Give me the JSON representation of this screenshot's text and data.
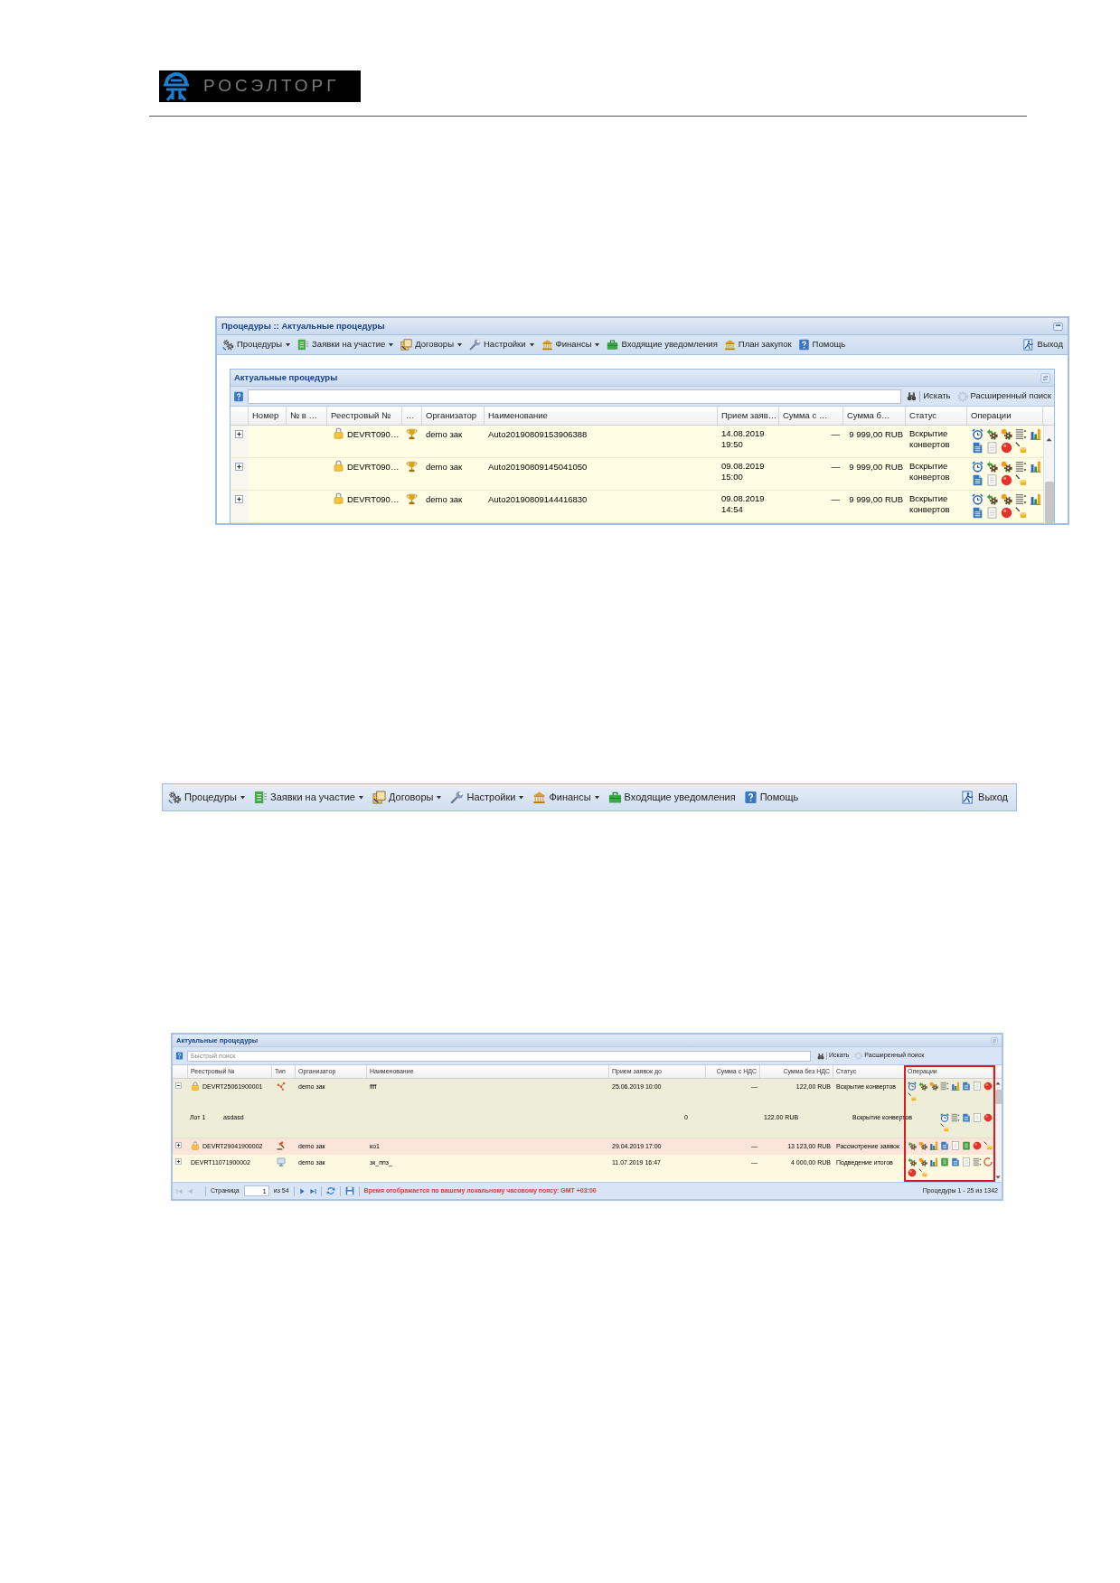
{
  "header": {
    "logo_text": "РОСЭЛТОРГ"
  },
  "procedures_window": {
    "title": "Процедуры :: Актуальные процедуры",
    "toolbar": {
      "items": [
        {
          "kind": "gears",
          "label": "Процедуры",
          "dropdown": true
        },
        {
          "kind": "sheet",
          "label": "Заявки на участие",
          "dropdown": true
        },
        {
          "kind": "documents",
          "label": "Договоры",
          "dropdown": true
        },
        {
          "kind": "wrench",
          "label": "Настройки",
          "dropdown": true
        },
        {
          "kind": "bank",
          "label": "Финансы",
          "dropdown": true
        },
        {
          "kind": "briefcase",
          "label": "Входящие уведомления",
          "dropdown": false
        },
        {
          "kind": "bank",
          "label": "План закупок",
          "dropdown": false
        },
        {
          "kind": "help",
          "label": "Помощь",
          "dropdown": false
        }
      ],
      "exit": "Выход"
    },
    "panel": {
      "title": "Актуальные процедуры",
      "search": {
        "button": "Искать",
        "advanced": "Расширенный поиск"
      },
      "columns": [
        "Номер",
        "№ в …",
        "Реестровый №",
        "…",
        "Организатор",
        "Наименование",
        "Прием заяв…",
        "Сумма с …",
        "Сумма б…",
        "Статус",
        "Операции"
      ],
      "rows": [
        {
          "kind": "trophy",
          "expanded": false,
          "locked": true,
          "registry_no": "DEVRT090…",
          "organizer": "demo зак",
          "name": "Auto20190809153906388",
          "deadline": "14.08.2019 19:50",
          "sum_vat": "—",
          "sum_no_vat": "9 999,00 RUB",
          "status": "Вскрытие конвертов",
          "operations": [
            {
              "kind": "timer"
            },
            {
              "kind": "gear_arrow"
            },
            {
              "kind": "gear_star"
            },
            {
              "kind": "list"
            },
            {
              "kind": "chart"
            },
            {
              "kind": "document"
            },
            {
              "kind": "page"
            },
            {
              "kind": "ball"
            },
            {
              "kind": "pencil_cylinder"
            }
          ]
        },
        {
          "kind": "trophy",
          "expanded": false,
          "locked": true,
          "registry_no": "DEVRT090…",
          "organizer": "demo зак",
          "name": "Auto20190809145041050",
          "deadline": "09.08.2019 15:00",
          "sum_vat": "—",
          "sum_no_vat": "9 999,00 RUB",
          "status": "Вскрытие конвертов",
          "operations": [
            {
              "kind": "timer"
            },
            {
              "kind": "gear_arrow"
            },
            {
              "kind": "gear_star"
            },
            {
              "kind": "list"
            },
            {
              "kind": "chart"
            },
            {
              "kind": "document"
            },
            {
              "kind": "page"
            },
            {
              "kind": "ball"
            },
            {
              "kind": "pencil_cylinder"
            }
          ]
        },
        {
          "kind": "trophy",
          "expanded": false,
          "locked": true,
          "registry_no": "DEVRT090…",
          "organizer": "demo зак",
          "name": "Auto20190809144416830",
          "deadline": "09.08.2019 14:54",
          "sum_vat": "—",
          "sum_no_vat": "9 999,00 RUB",
          "status": "Вскрытие конвертов",
          "operations": [
            {
              "kind": "timer"
            },
            {
              "kind": "gear_arrow"
            },
            {
              "kind": "gear_star"
            },
            {
              "kind": "list"
            },
            {
              "kind": "chart"
            },
            {
              "kind": "document"
            },
            {
              "kind": "page"
            },
            {
              "kind": "ball"
            },
            {
              "kind": "pencil_cylinder"
            }
          ]
        }
      ]
    }
  },
  "toolbar_example": {
    "items": [
      {
        "kind": "gears",
        "label": "Процедуры",
        "dropdown": true
      },
      {
        "kind": "sheet",
        "label": "Заявки на участие",
        "dropdown": true
      },
      {
        "kind": "documents",
        "label": "Договоры",
        "dropdown": true
      },
      {
        "kind": "wrench",
        "label": "Настройки",
        "dropdown": true
      },
      {
        "kind": "bank",
        "label": "Финансы",
        "dropdown": true
      },
      {
        "kind": "briefcase",
        "label": "Входящие уведомления",
        "dropdown": false
      },
      {
        "kind": "help",
        "label": "Помощь",
        "dropdown": false
      }
    ],
    "exit": "Выход"
  },
  "procedures_grid": {
    "title": "Актуальные процедуры",
    "search": {
      "placeholder": "Быстрый поиск",
      "button": "Искать",
      "advanced": "Расширенный поиск"
    },
    "columns": [
      {
        "label": "Реестровый №",
        "highlighted": false
      },
      {
        "label": "Тип",
        "highlighted": false
      },
      {
        "label": "Организатор",
        "highlighted": false
      },
      {
        "label": "Наименование",
        "highlighted": false
      },
      {
        "label": "Прием заявок до",
        "highlighted": false
      },
      {
        "label": "Сумма с НДС",
        "highlighted": false
      },
      {
        "label": "Сумма без НДС",
        "highlighted": false
      },
      {
        "label": "Статус",
        "highlighted": false
      },
      {
        "label": "Операции",
        "highlighted": true
      }
    ],
    "rows": [
      {
        "kind": "network",
        "expanded": true,
        "locked": true,
        "registry_no": "DEVRT25061900001",
        "organizer": "demo зак",
        "name": "ffff",
        "deadline": "25.06.2019 10:00",
        "sum_vat": "—",
        "sum_no_vat": "122,00 RUB",
        "status": "Вскрытие конвертов",
        "color": "#eeeed8",
        "operations": [
          {
            "kind": "timer"
          },
          {
            "kind": "gear_arrow"
          },
          {
            "kind": "gear_star"
          },
          {
            "kind": "list"
          },
          {
            "kind": "chart"
          },
          {
            "kind": "document"
          },
          {
            "kind": "page"
          },
          {
            "kind": "ball"
          },
          {
            "kind": "pencil_cylinder"
          }
        ],
        "lots": [
          {
            "label": "Лот 1",
            "name": "asdasd",
            "sum_vat": "0",
            "sum_no_vat": "122.00 RUB",
            "status": "Вскрытие конвертов",
            "operations": [
              {
                "kind": "timer"
              },
              {
                "kind": "list"
              },
              {
                "kind": "document"
              },
              {
                "kind": "page"
              },
              {
                "kind": "ball"
              },
              {
                "kind": "pencil_cylinder"
              }
            ]
          }
        ]
      },
      {
        "kind": "gavel",
        "expanded": false,
        "locked": true,
        "registry_no": "DEVRT29041900002",
        "organizer": "demo зак",
        "name": "ко1",
        "deadline": "29.04.2019 17:00",
        "sum_vat": "—",
        "sum_no_vat": "13 123,00 RUB",
        "status": "Рассмотрение заявок",
        "color": "#fbe4d9",
        "operations": [
          {
            "kind": "gear_arrow"
          },
          {
            "kind": "gear_star"
          },
          {
            "kind": "chart"
          },
          {
            "kind": "document"
          },
          {
            "kind": "page"
          },
          {
            "kind": "sheet"
          },
          {
            "kind": "ball"
          },
          {
            "kind": "pencil_cylinder"
          }
        ]
      },
      {
        "kind": "monitor",
        "expanded": false,
        "locked": false,
        "registry_no": "DEVRT11071900002",
        "organizer": "demo зак",
        "name": "зк_ппз_",
        "deadline": "11.07.2019 16:47",
        "sum_vat": "—",
        "sum_no_vat": "4 000,00 RUB",
        "status": "Подведение итогов",
        "color": "#fdf9e1",
        "operations": [
          {
            "kind": "gear_arrow"
          },
          {
            "kind": "gear_star"
          },
          {
            "kind": "chart"
          },
          {
            "kind": "sheet"
          },
          {
            "kind": "document"
          },
          {
            "kind": "page"
          },
          {
            "kind": "list"
          },
          {
            "kind": "ring"
          },
          {
            "kind": "ball"
          },
          {
            "kind": "pencil_cylinder"
          }
        ]
      }
    ],
    "paging": {
      "prev_disabled": true,
      "next_disabled": false,
      "page_label": "Страница",
      "page": "1",
      "page_count": "из 54",
      "note": "Время отображается по вашему локальному часовому поясу: GMT +03:00",
      "summary": "Процедуры 1 - 25 из 1342"
    }
  }
}
